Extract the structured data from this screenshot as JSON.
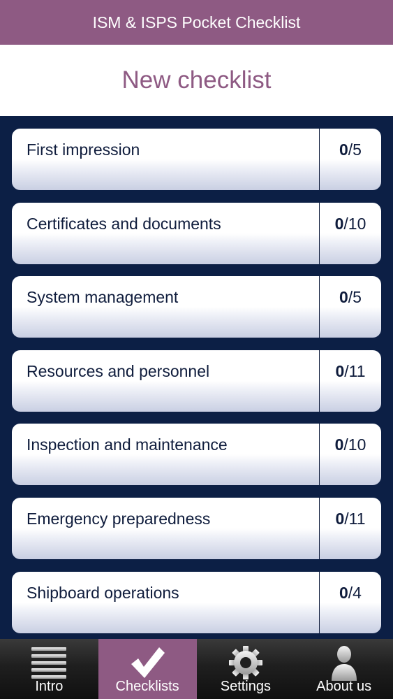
{
  "header": {
    "title": "ISM & ISPS Pocket Checklist"
  },
  "page": {
    "title": "New checklist"
  },
  "checklists": [
    {
      "label": "First impression",
      "done": "0",
      "total": "/5"
    },
    {
      "label": "Certificates and documents",
      "done": "0",
      "total": "/10"
    },
    {
      "label": "System management",
      "done": "0",
      "total": "/5"
    },
    {
      "label": "Resources and personnel",
      "done": "0",
      "total": "/11"
    },
    {
      "label": "Inspection and maintenance",
      "done": "0",
      "total": "/10"
    },
    {
      "label": "Emergency preparedness",
      "done": "0",
      "total": "/11"
    },
    {
      "label": "Shipboard operations",
      "done": "0",
      "total": "/4"
    }
  ],
  "tabs": [
    {
      "label": "Intro",
      "icon": "menu-lines-icon"
    },
    {
      "label": "Checklists",
      "icon": "checkmark-icon",
      "active": true
    },
    {
      "label": "Settings",
      "icon": "gear-icon"
    },
    {
      "label": "About us",
      "icon": "person-icon"
    }
  ],
  "colors": {
    "brand": "#8e5a83",
    "background": "#0c1f45",
    "text": "#0f1c3c"
  }
}
